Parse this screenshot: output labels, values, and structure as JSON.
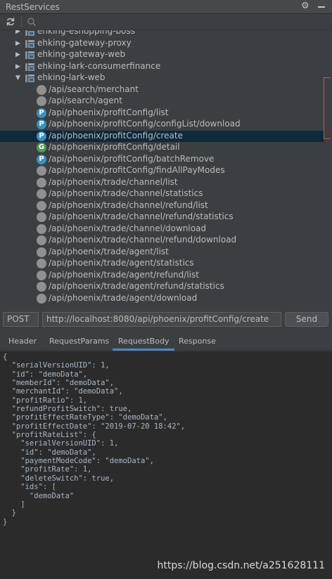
{
  "window": {
    "title": "RestServices"
  },
  "toolbar": {
    "refresh_icon": "refresh-icon",
    "search_icon": "search-icon"
  },
  "tree": {
    "modules": [
      {
        "label": "ehking-eshopping-boss",
        "expanded": false
      },
      {
        "label": "ehking-gateway-proxy",
        "expanded": false
      },
      {
        "label": "ehking-gateway-web",
        "expanded": false
      },
      {
        "label": "ehking-lark-consumerfinance",
        "expanded": false
      },
      {
        "label": "ehking-lark-web",
        "expanded": true
      }
    ],
    "endpoints": [
      {
        "path": "/api/search/merchant",
        "badge": ""
      },
      {
        "path": "/api/search/agent",
        "badge": ""
      },
      {
        "path": "/api/phoenix/profitConfig/list",
        "badge": "P"
      },
      {
        "path": "/api/phoenix/profitConfig/configList/download",
        "badge": "P"
      },
      {
        "path": "/api/phoenix/profitConfig/create",
        "badge": "P",
        "selected": true
      },
      {
        "path": "/api/phoenix/profitConfig/detail",
        "badge": "G"
      },
      {
        "path": "/api/phoenix/profitConfig/batchRemove",
        "badge": "P"
      },
      {
        "path": "/api/phoenix/profitConfig/findAllPayModes",
        "badge": ""
      },
      {
        "path": "/api/phoenix/trade/channel/list",
        "badge": ""
      },
      {
        "path": "/api/phoenix/trade/channel/statistics",
        "badge": ""
      },
      {
        "path": "/api/phoenix/trade/channel/refund/list",
        "badge": ""
      },
      {
        "path": "/api/phoenix/trade/channel/refund/statistics",
        "badge": ""
      },
      {
        "path": "/api/phoenix/trade/channel/download",
        "badge": ""
      },
      {
        "path": "/api/phoenix/trade/channel/refund/download",
        "badge": ""
      },
      {
        "path": "/api/phoenix/trade/agent/list",
        "badge": ""
      },
      {
        "path": "/api/phoenix/trade/agent/statistics",
        "badge": ""
      },
      {
        "path": "/api/phoenix/trade/agent/refund/list",
        "badge": ""
      },
      {
        "path": "/api/phoenix/trade/agent/refund/statistics",
        "badge": ""
      },
      {
        "path": "/api/phoenix/trade/agent/download",
        "badge": ""
      }
    ]
  },
  "request": {
    "method": "POST",
    "url": "http://localhost:8080/api/phoenix/profitConfig/create",
    "send_label": "Send"
  },
  "tabs": [
    {
      "label": "Header",
      "active": false
    },
    {
      "label": "RequestParams",
      "active": false
    },
    {
      "label": "RequestBody",
      "active": true
    },
    {
      "label": "Response",
      "active": false
    }
  ],
  "body_lines": [
    "{",
    "  \"serialVersionUID\": 1,",
    "  \"id\": \"demoData\",",
    "  \"memberId\": \"demoData\",",
    "  \"merchantId\": \"demoData\",",
    "  \"profitRatio\": 1,",
    "  \"refundProfitSwitch\": true,",
    "  \"profitEffectRateType\": \"demoData\",",
    "  \"profitEffectDate\": \"2019-07-20 18:42\",",
    "  \"profitRateList\": {",
    "    \"serialVersionUID\": 1,",
    "    \"id\": \"demoData\",",
    "    \"paymentModeCode\": \"demoData\",",
    "    \"profitRate\": 1,",
    "    \"deleteSwitch\": true,",
    "    \"ids\": [",
    "      \"demoData\"",
    "    ]",
    "  }",
    "}"
  ],
  "watermark": "https://blog.csdn.net/a251628111"
}
